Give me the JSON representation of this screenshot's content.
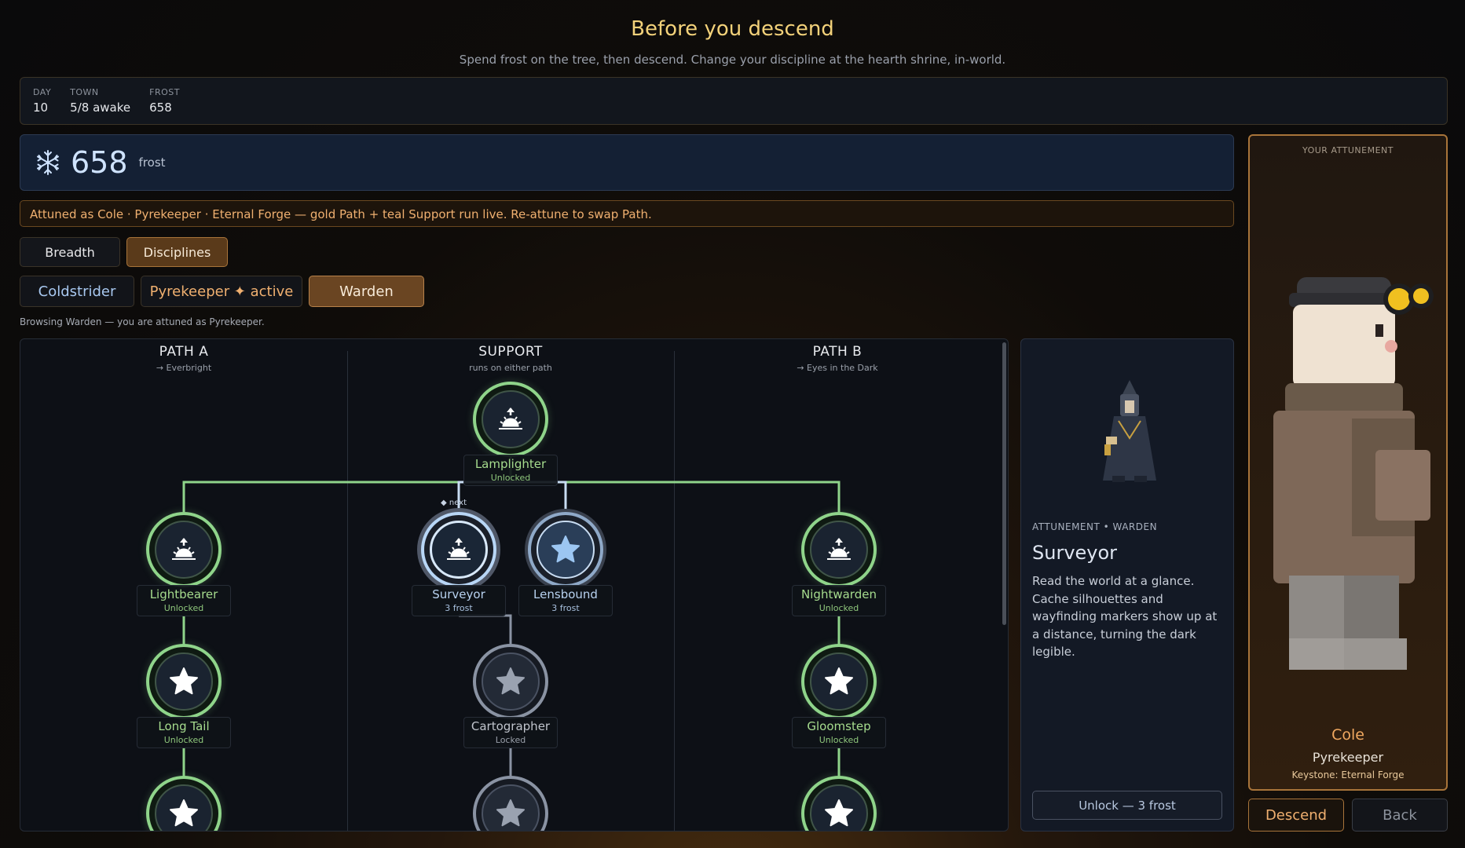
{
  "header": {
    "title": "Before you descend",
    "subtitle": "Spend frost on the tree, then descend. Change your discipline at the hearth shrine, in-world."
  },
  "stats": [
    {
      "key": "DAY",
      "value": "10"
    },
    {
      "key": "TOWN",
      "value": "5/8 awake"
    },
    {
      "key": "FROST",
      "value": "658"
    }
  ],
  "frost": {
    "amount": "658",
    "unit": "frost",
    "icon": "snowflake-icon"
  },
  "notice": "Attuned as Cole · Pyrekeeper · Eternal Forge — gold Path + teal Support run live. Re-attune to swap Path.",
  "tabs": [
    {
      "label": "Breadth",
      "selected": false
    },
    {
      "label": "Disciplines",
      "selected": true
    }
  ],
  "disciplines": [
    {
      "label": "Coldstrider",
      "color": "#a8c8f0",
      "selected": false
    },
    {
      "label": "Pyrekeeper ✦ active",
      "color": "#f0b070",
      "selected": false
    },
    {
      "label": "Warden",
      "color": "#f7ead8",
      "selected": true
    }
  ],
  "browse_note": "Browsing Warden — you are attuned as Pyrekeeper.",
  "tree": {
    "columns": [
      {
        "heading": "PATH A",
        "sub": "→ Everbright"
      },
      {
        "heading": "SUPPORT",
        "sub": "runs on either path"
      },
      {
        "heading": "PATH B",
        "sub": "→ Eyes in the Dark"
      }
    ],
    "next_marker": "◆ next",
    "nodes": [
      {
        "name": "Lamplighter",
        "status": "Unlocked",
        "icon": "sunrise-icon",
        "state": "unlocked"
      },
      {
        "name": "Lightbearer",
        "status": "Unlocked",
        "icon": "sunrise-icon",
        "state": "unlocked"
      },
      {
        "name": "Surveyor",
        "status": "3 frost",
        "icon": "sunrise-icon",
        "state": "selected"
      },
      {
        "name": "Lensbound",
        "status": "3 frost",
        "icon": "star-icon",
        "state": "available"
      },
      {
        "name": "Nightwarden",
        "status": "Unlocked",
        "icon": "sunrise-icon",
        "state": "unlocked"
      },
      {
        "name": "Long Tail",
        "status": "Unlocked",
        "icon": "star-icon",
        "state": "unlocked"
      },
      {
        "name": "Cartographer",
        "status": "Locked",
        "icon": "star-icon",
        "state": "locked"
      },
      {
        "name": "Gloomstep",
        "status": "Unlocked",
        "icon": "star-icon",
        "state": "unlocked"
      },
      {
        "name": "",
        "status": "",
        "icon": "star-icon",
        "state": "unlocked"
      },
      {
        "name": "",
        "status": "",
        "icon": "star-icon",
        "state": "locked"
      },
      {
        "name": "",
        "status": "",
        "icon": "star-icon",
        "state": "unlocked"
      }
    ]
  },
  "detail": {
    "meta": "ATTUNEMENT • WARDEN",
    "name": "Surveyor",
    "description": "Read the world at a glance. Cache silhouettes and wayfinding markers show up at a distance, turning the dark legible.",
    "unlock_label": "Unlock — 3 frost"
  },
  "attunement": {
    "heading": "YOUR ATTUNEMENT",
    "character": "Cole",
    "discipline": "Pyrekeeper",
    "keystone": "Keystone: Eternal Forge"
  },
  "actions": {
    "descend": "Descend",
    "back": "Back"
  },
  "colors": {
    "gold": "#f3d27a",
    "unlocked_green": "#8fd48a",
    "accent_orange": "#f0a860",
    "selected_blue": "#b8d6f6"
  }
}
